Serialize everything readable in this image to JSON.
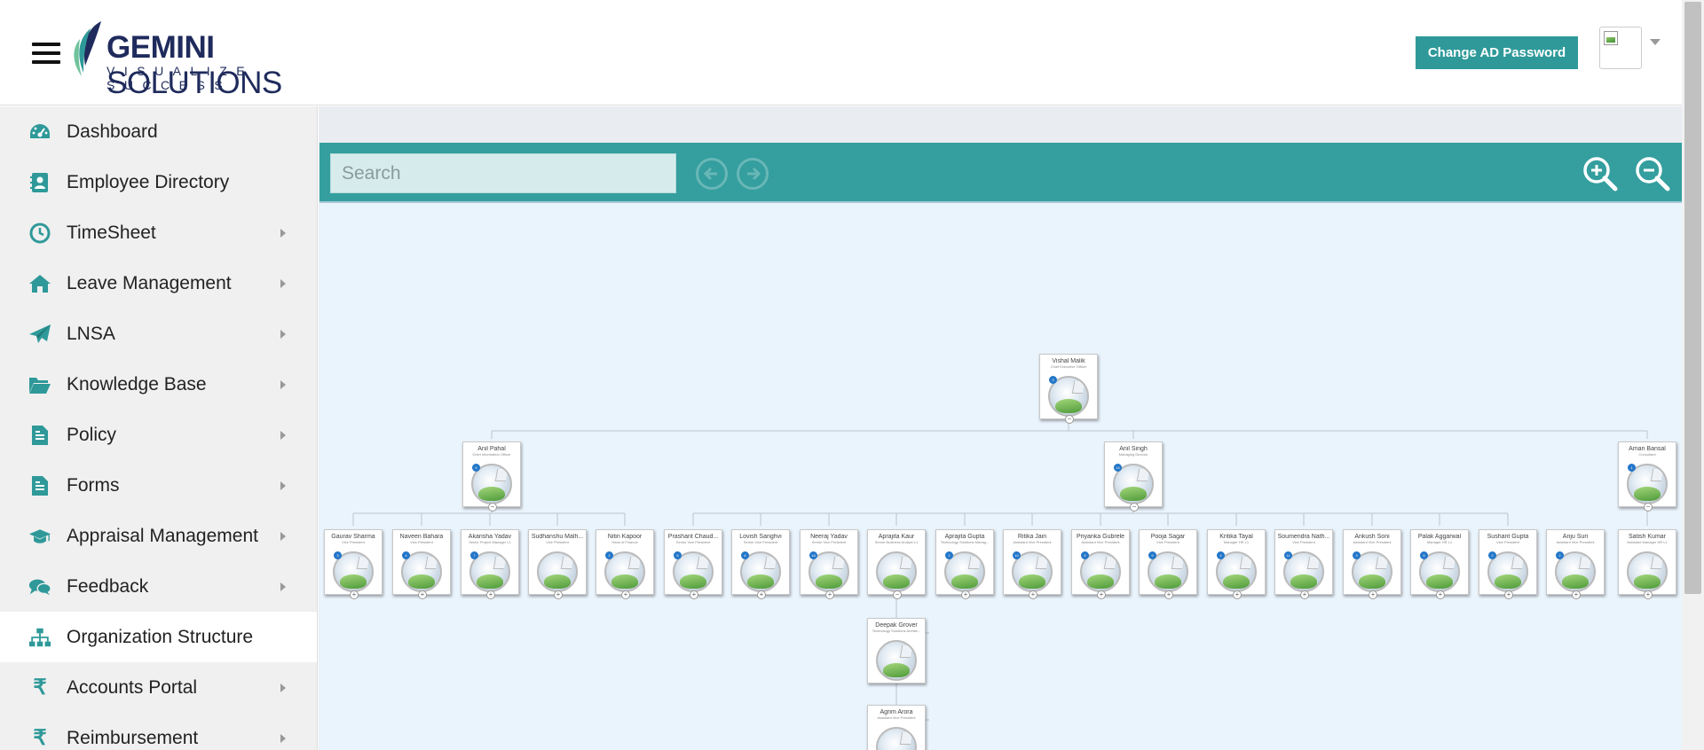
{
  "header": {
    "brand_primary": "GEMINI",
    "brand_secondary": "SOLUTIONS",
    "tagline": "VISUALIZE SUCCESS",
    "change_password_label": "Change AD Password",
    "accent_color": "#2f9999"
  },
  "sidebar": {
    "items": [
      {
        "label": "Dashboard",
        "icon": "dashboard-icon",
        "has_submenu": false
      },
      {
        "label": "Employee Directory",
        "icon": "address-book-icon",
        "has_submenu": false
      },
      {
        "label": "TimeSheet",
        "icon": "clock-icon",
        "has_submenu": true
      },
      {
        "label": "Leave Management",
        "icon": "home-icon",
        "has_submenu": true
      },
      {
        "label": "LNSA",
        "icon": "paper-plane-icon",
        "has_submenu": true
      },
      {
        "label": "Knowledge Base",
        "icon": "folder-open-icon",
        "has_submenu": true
      },
      {
        "label": "Policy",
        "icon": "document-icon",
        "has_submenu": true
      },
      {
        "label": "Forms",
        "icon": "document-icon",
        "has_submenu": true
      },
      {
        "label": "Appraisal Management",
        "icon": "graduation-cap-icon",
        "has_submenu": true
      },
      {
        "label": "Feedback",
        "icon": "chat-bubbles-icon",
        "has_submenu": true
      },
      {
        "label": "Organization Structure",
        "icon": "sitemap-icon",
        "has_submenu": false,
        "active": true
      },
      {
        "label": "Accounts Portal",
        "icon": "rupee-icon",
        "has_submenu": true
      },
      {
        "label": "Reimbursement",
        "icon": "rupee-icon",
        "has_submenu": true
      }
    ]
  },
  "toolbar": {
    "search_placeholder": "Search"
  },
  "org_chart": {
    "root": {
      "name": "Vishal Malik",
      "title": "Chief Executive Officer",
      "count": "3"
    },
    "level1": [
      {
        "name": "Anil Pahal",
        "title": "Chief Information Officer",
        "count": "5"
      },
      {
        "name": "Anil Singh",
        "title": "Managing Director",
        "count": "14"
      },
      {
        "name": "Aman Bansal",
        "title": "Consultant",
        "count": "1"
      }
    ],
    "level2": [
      {
        "name": "Gaurav Sharma",
        "title": "Vice President",
        "count": "3"
      },
      {
        "name": "Naveen Bahara",
        "title": "Vice President",
        "count": "4"
      },
      {
        "name": "Akansha Yadav",
        "title": "Senior Project Manager L1",
        "count": "7"
      },
      {
        "name": "Sudhanshu Malh...",
        "title": "Vice President",
        "count": ""
      },
      {
        "name": "Nitin Kapoor",
        "title": "Head of Finance",
        "count": "2"
      },
      {
        "name": "Prashant Chaud...",
        "title": "Senior Vice President",
        "count": "5"
      },
      {
        "name": "Lovish Sanghvi",
        "title": "Senior Vice President",
        "count": "6"
      },
      {
        "name": "Neeraj Yadav",
        "title": "Senior Vice President",
        "count": "18"
      },
      {
        "name": "Aprajita Kaur",
        "title": "Senior Business Analyst L1",
        "count": ""
      },
      {
        "name": "Aprajita Gupta",
        "title": "Technology Solutions Manag...",
        "count": "2"
      },
      {
        "name": "Ritika Jain",
        "title": "Assistant Vice President",
        "count": "10"
      },
      {
        "name": "Priyanka Gubrele",
        "title": "Assistant Vice President",
        "count": "5"
      },
      {
        "name": "Pooja Sagar",
        "title": "Vice President",
        "count": "9"
      },
      {
        "name": "Kritika Tayal",
        "title": "Manager HR L1",
        "count": "4"
      },
      {
        "name": "Soumendra Nath...",
        "title": "Vice President",
        "count": "11"
      },
      {
        "name": "Ankush Soni",
        "title": "Assistant Vice President",
        "count": "3"
      },
      {
        "name": "Palak Aggarwal",
        "title": "Manager HR L1",
        "count": "5"
      },
      {
        "name": "Sushant Gupta",
        "title": "Vice President",
        "count": "2"
      },
      {
        "name": "Anju Suri",
        "title": "Assistant Vice President",
        "count": "2"
      },
      {
        "name": "Satish Kumar",
        "title": "Assistant Manager HR L1",
        "count": ""
      }
    ],
    "level3": [
      {
        "name": "Deepak Grover",
        "title": "Technology Solutions Archite...",
        "count": ""
      },
      {
        "name": "Agrim Arora",
        "title": "Assistant Vice President",
        "count": ""
      }
    ]
  }
}
